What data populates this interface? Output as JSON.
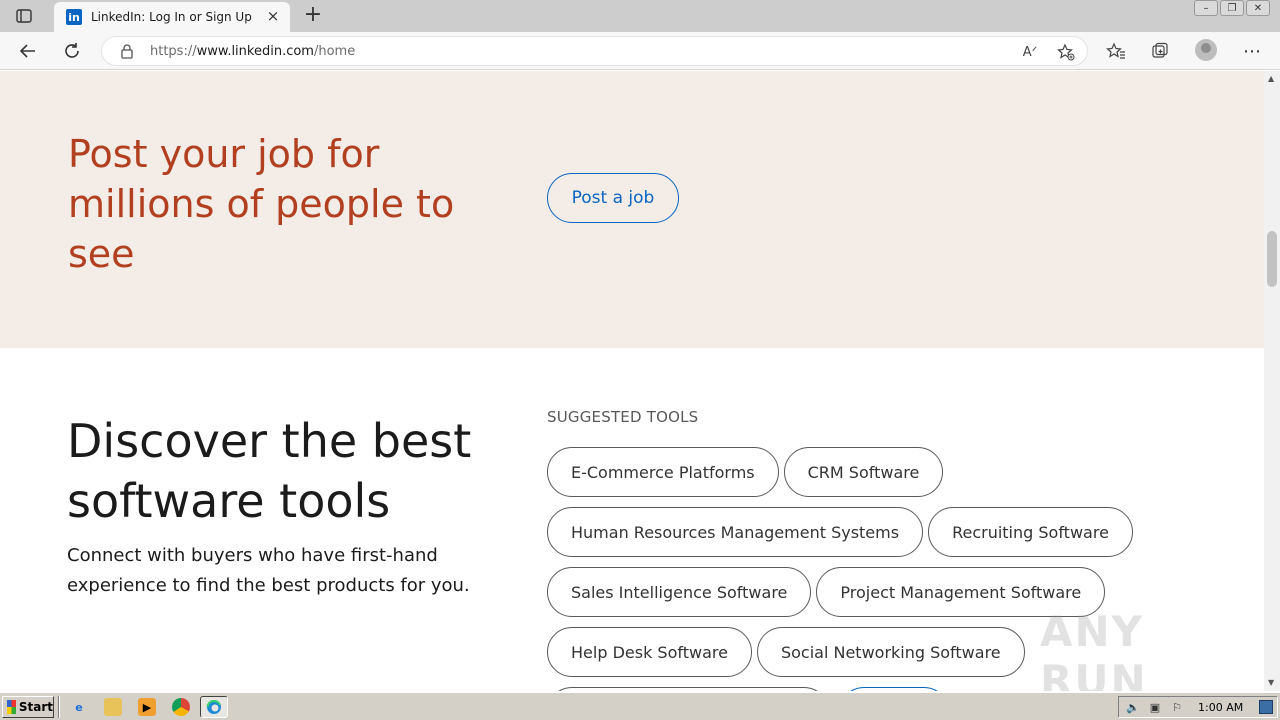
{
  "browser": {
    "tab_title": "LinkedIn: Log In or Sign Up",
    "tab_favicon_text": "in",
    "url_prefix": "https://",
    "url_host": "www.linkedin.com",
    "url_path": "/home",
    "read_aloud_icon": "read-aloud-icon",
    "accent": "#0a66c2"
  },
  "post_job": {
    "headline": "Post your job for millions of people to see",
    "button_label": "Post a job",
    "band_color": "#f3ece7",
    "headline_color": "#b24020"
  },
  "discover": {
    "headline": "Discover the best software tools",
    "subtitle": "Connect with buyers who have first-hand experience to find the best products for you."
  },
  "suggested_tools": {
    "label": "SUGGESTED TOOLS",
    "rows": [
      [
        "E-Commerce Platforms",
        "CRM Software"
      ],
      [
        "Human Resources Management Systems",
        "Recruiting Software"
      ],
      [
        "Sales Intelligence Software",
        "Project Management Software"
      ],
      [
        "Help Desk Software",
        "Social Networking Software"
      ]
    ]
  },
  "watermark": "ANY RUN",
  "taskbar": {
    "start_label": "Start",
    "clock": "1:00 AM"
  }
}
